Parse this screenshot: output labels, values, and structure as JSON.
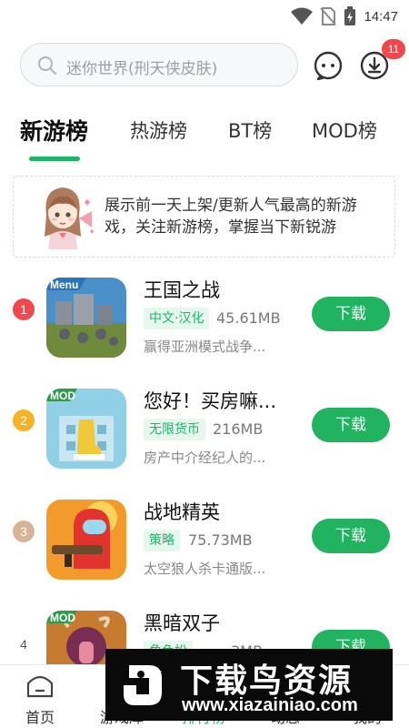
{
  "status_bar": {
    "time": "14:47"
  },
  "search": {
    "placeholder": "迷你世界(刑天侠皮肤)"
  },
  "header": {
    "download_badge": "11"
  },
  "tabs": [
    {
      "label": "新游榜",
      "active": true
    },
    {
      "label": "热游榜",
      "active": false
    },
    {
      "label": "BT榜",
      "active": false
    },
    {
      "label": "MOD榜",
      "active": false
    }
  ],
  "banner": {
    "text": "展示前一天上架/更新人气最高的新游戏，关注新游榜，掌握当下新锐游"
  },
  "games": [
    {
      "rank": "1",
      "title": "王国之战",
      "tag": "中文·汉化",
      "size": "45.61MB",
      "subtitle": "赢得亚洲模式战争...",
      "button": "下载",
      "icon_label": "Menu"
    },
    {
      "rank": "2",
      "title": "您好！买房嘛...",
      "tag": "无限货币",
      "size": "216MB",
      "subtitle": "房产中介经纪人的...",
      "button": "下载",
      "icon_label": "MOD"
    },
    {
      "rank": "3",
      "title": "战地精英",
      "tag": "策略",
      "size": "75.73MB",
      "subtitle": "太空狼人杀卡通版...",
      "button": "下载"
    },
    {
      "rank": "4",
      "title": "黑暗双子",
      "tag": "角色扮",
      "size": "…3MB",
      "subtitle": "",
      "button": "下载",
      "icon_label": "MOD"
    }
  ],
  "bottom_nav": [
    {
      "label": "首页"
    },
    {
      "label": "游戏库"
    },
    {
      "label": "排行榜"
    },
    {
      "label": "动态"
    },
    {
      "label": "我的"
    }
  ],
  "watermark": {
    "title": "下载鸟资源",
    "url": "www.xiazainiao.com"
  },
  "colors": {
    "accent": "#21b35f",
    "rank1": "#f0484c",
    "rank2": "#f5b324",
    "rank3": "#d8b494",
    "badge": "#f0484c"
  }
}
